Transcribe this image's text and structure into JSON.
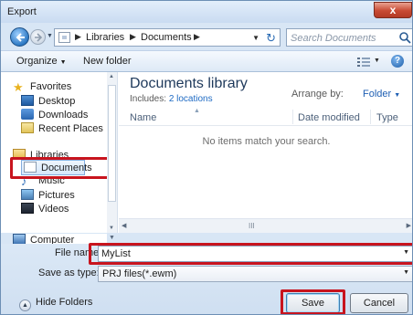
{
  "window": {
    "title": "Export",
    "close_label": "x"
  },
  "address": {
    "crumbs": [
      "Libraries",
      "Documents"
    ],
    "search_placeholder": "Search Documents"
  },
  "toolbar": {
    "organize_label": "Organize",
    "new_folder_label": "New folder"
  },
  "nav": {
    "favorites": {
      "label": "Favorites",
      "items": [
        "Desktop",
        "Downloads",
        "Recent Places"
      ]
    },
    "libraries": {
      "label": "Libraries",
      "items": [
        "Documents",
        "Music",
        "Pictures",
        "Videos"
      ]
    },
    "computer": {
      "label": "Computer"
    },
    "selected_item": "Documents"
  },
  "content": {
    "library_title": "Documents library",
    "includes_label": "Includes:",
    "includes_link": "2 locations",
    "arrange_label": "Arrange by:",
    "arrange_value": "Folder",
    "columns": [
      "Name",
      "Date modified",
      "Type"
    ],
    "empty_message": "No items match your search.",
    "scroll_grip": "III"
  },
  "bottom": {
    "file_name_label": "File name:",
    "file_name_value": "MyList",
    "save_type_label": "Save as type:",
    "save_type_value": "PRJ files(*.ewm)",
    "hide_folders_label": "Hide Folders",
    "save_label": "Save",
    "cancel_label": "Cancel"
  },
  "colors": {
    "highlight_red": "#c8141e",
    "link_blue": "#1f6bc4",
    "title_blue": "#1e395b"
  }
}
